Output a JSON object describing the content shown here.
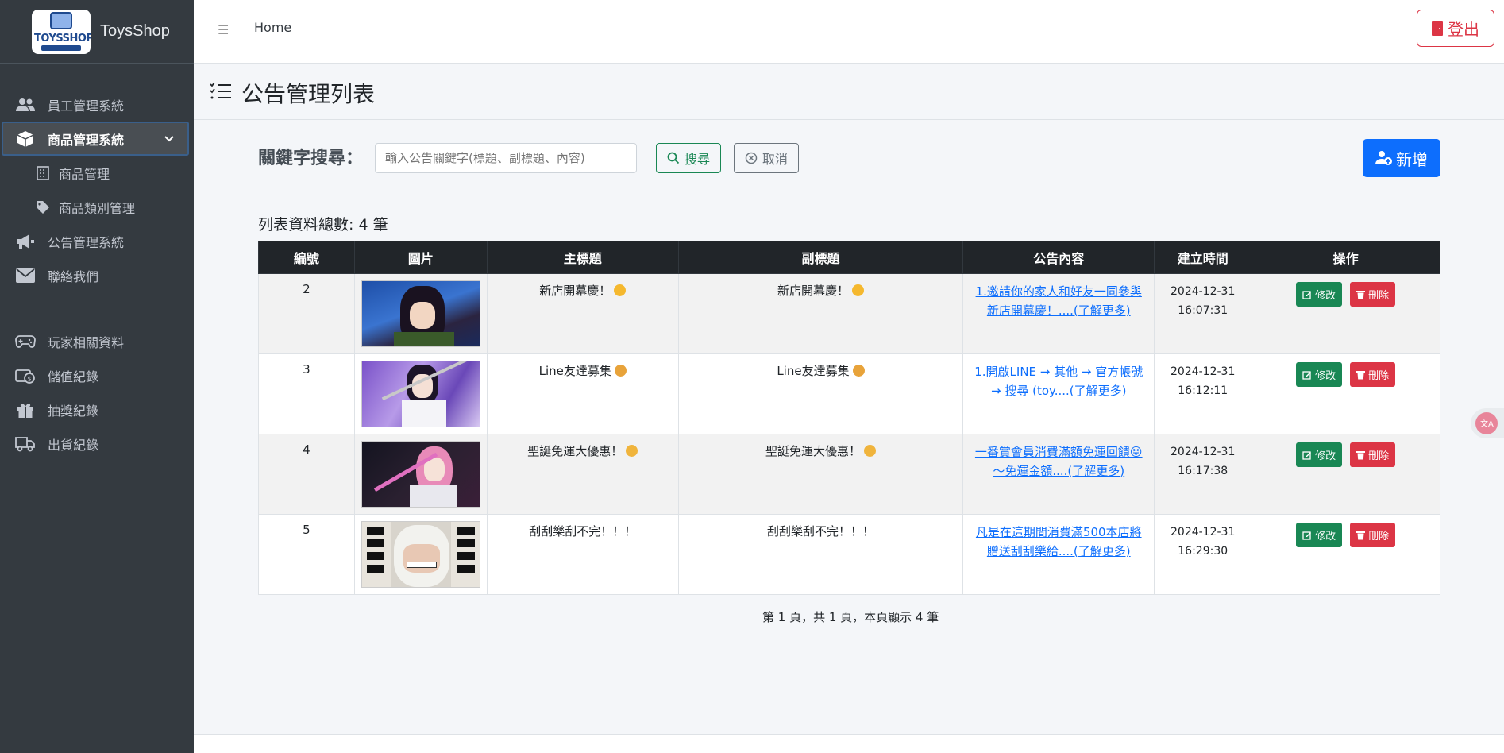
{
  "brand": {
    "name": "ToysShop",
    "logo_text": "TOYSSHOP"
  },
  "sidebar": {
    "items": [
      {
        "label": "員工管理系統",
        "icon": "users-icon"
      },
      {
        "label": "商品管理系統",
        "icon": "box-icon"
      },
      {
        "label": "商品管理",
        "icon": "building-icon"
      },
      {
        "label": "商品類別管理",
        "icon": "tags-icon"
      },
      {
        "label": "公告管理系統",
        "icon": "megaphone-icon"
      },
      {
        "label": "聯絡我們",
        "icon": "envelope-icon"
      },
      {
        "label": "玩家相關資料",
        "icon": "gamepad-icon"
      },
      {
        "label": "儲值紀錄",
        "icon": "coins-icon"
      },
      {
        "label": "抽獎紀錄",
        "icon": "gift-icon"
      },
      {
        "label": "出貨紀錄",
        "icon": "truck-icon"
      }
    ]
  },
  "topbar": {
    "home": "Home",
    "logout": "登出"
  },
  "header": {
    "title": "公告管理列表"
  },
  "search": {
    "label": "關鍵字搜尋：",
    "placeholder": "輸入公告關鍵字(標題、副標題、內容)",
    "search_label": "搜尋",
    "cancel_label": "取消",
    "add_label": "新增"
  },
  "list": {
    "total": "列表資料總數: 4 筆",
    "headers": [
      "編號",
      "圖片",
      "主標題",
      "副標題",
      "公告內容",
      "建立時間",
      "操作"
    ],
    "edit_label": "修改",
    "delete_label": "刪除",
    "rows": [
      {
        "id": "2",
        "title": "新店開幕慶！",
        "subtitle": "新店開幕慶！",
        "emoji_color": "#f5b82e",
        "content": "1.邀請你的家人和好友一同參與新店開幕慶！....(了解更多)",
        "date": "2024-12-31",
        "time": "16:07:31"
      },
      {
        "id": "3",
        "title": "Line友達募集",
        "subtitle": "Line友達募集",
        "emoji_color": "#e8a33a",
        "content": "1.開啟LINE → 其他 → 官方帳號 → 搜尋 (toy....(了解更多)",
        "date": "2024-12-31",
        "time": "16:12:11"
      },
      {
        "id": "4",
        "title": "聖誕免運大優惠！",
        "subtitle": "聖誕免運大優惠！",
        "emoji_color": "#f0b43c",
        "content": "一番賞會員消費滿額免運回饋😝～免運金額....(了解更多)",
        "date": "2024-12-31",
        "time": "16:17:38"
      },
      {
        "id": "5",
        "title": "刮刮樂刮不完！！！",
        "subtitle": "刮刮樂刮不完！！！",
        "emoji_color": "",
        "content": "凡是在這期間消費滿500本店將贈送刮刮樂給....(了解更多)",
        "date": "2024-12-31",
        "time": "16:29:30"
      }
    ]
  },
  "pagination": {
    "info": "第 1 頁，共 1 頁，本頁顯示 4 筆"
  },
  "colors": {
    "sidebar_bg": "#343a40",
    "primary": "#0d6efd",
    "success": "#198754",
    "danger": "#dc3545"
  }
}
